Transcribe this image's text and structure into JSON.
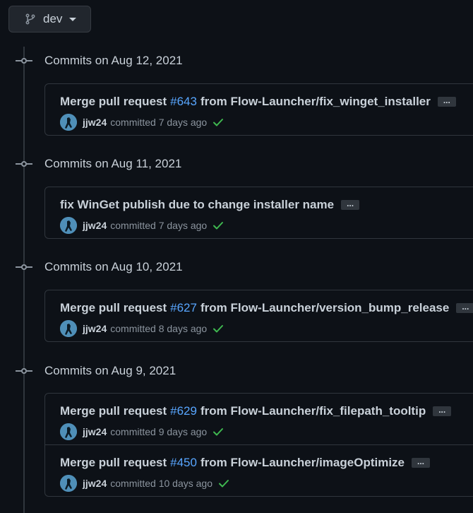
{
  "branch": {
    "name": "dev"
  },
  "groups": [
    {
      "title": "Commits on Aug 12, 2021",
      "commits": [
        {
          "msg_prefix": "Merge pull request",
          "pr": "#643",
          "msg_suffix": "from Flow-Launcher/fix_winget_installer",
          "author": "jjw24",
          "committed": "committed",
          "time": "7 days ago"
        }
      ]
    },
    {
      "title": "Commits on Aug 11, 2021",
      "commits": [
        {
          "msg_prefix": "fix WinGet publish due to change installer name",
          "pr": "",
          "msg_suffix": "",
          "author": "jjw24",
          "committed": "committed",
          "time": "7 days ago"
        }
      ]
    },
    {
      "title": "Commits on Aug 10, 2021",
      "commits": [
        {
          "msg_prefix": "Merge pull request",
          "pr": "#627",
          "msg_suffix": "from Flow-Launcher/version_bump_release",
          "author": "jjw24",
          "committed": "committed",
          "time": "8 days ago"
        }
      ]
    },
    {
      "title": "Commits on Aug 9, 2021",
      "commits": [
        {
          "msg_prefix": "Merge pull request",
          "pr": "#629",
          "msg_suffix": "from Flow-Launcher/fix_filepath_tooltip",
          "author": "jjw24",
          "committed": "committed",
          "time": "9 days ago"
        },
        {
          "msg_prefix": "Merge pull request",
          "pr": "#450",
          "msg_suffix": "from Flow-Launcher/imageOptimize",
          "author": "jjw24",
          "committed": "committed",
          "time": "10 days ago"
        }
      ]
    }
  ],
  "ellipsis": "...",
  "colors": {
    "bg": "#0d1117",
    "link": "#58a6ff",
    "check": "#3fb950",
    "border": "#30363d"
  },
  "icons": {
    "branch": "git-branch-icon",
    "dot": "git-commit-icon",
    "check": "check-icon",
    "caret": "caret-down-icon"
  }
}
